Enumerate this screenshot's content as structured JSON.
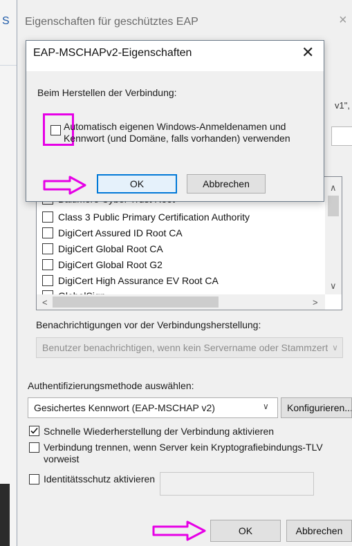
{
  "background_window": {
    "edge_letter": "S"
  },
  "main_dialog": {
    "title": "Eigenschaften für geschütztes EAP",
    "close_glyph": "×",
    "hidden_fragment": "v1\",",
    "certificates": [
      {
        "label": "Baltimore Cyber Trust Root",
        "checked": false
      },
      {
        "label": "Class 3 Public Primary Certification Authority",
        "checked": false
      },
      {
        "label": "DigiCert Assured ID Root CA",
        "checked": false
      },
      {
        "label": "DigiCert Global Root CA",
        "checked": false
      },
      {
        "label": "DigiCert Global Root G2",
        "checked": false
      },
      {
        "label": "DigiCert High Assurance EV Root CA",
        "checked": false
      },
      {
        "label": "GlobalSign",
        "checked": false
      }
    ],
    "scroll_up": "∧",
    "scroll_down": "∨",
    "scroll_left": "<",
    "scroll_right": ">",
    "notify_label": "Benachrichtigungen vor der Verbindungsherstellung:",
    "notify_value": "Benutzer benachrichtigen, wenn kein Servername oder Stammzertifikat angegeben ist",
    "auth_method_label": "Authentifizierungsmethode auswählen:",
    "auth_method_value": "Gesichertes Kennwort (EAP-MSCHAP v2)",
    "configure_label": "Konfigurieren...",
    "fast_reconnect_label": "Schnelle Wiederherstellung der Verbindung aktivieren",
    "fast_reconnect_checked": true,
    "disconnect_label": "Verbindung trennen, wenn Server kein Kryptografiebindungs-TLV vorweist",
    "disconnect_checked": false,
    "identity_label": "Identitätsschutz aktivieren",
    "identity_checked": false,
    "ok_label": "OK",
    "cancel_label": "Abbrechen"
  },
  "mschap_dialog": {
    "title": "EAP-MSCHAPv2-Eigenschaften",
    "close_glyph": "✕",
    "section_label": "Beim Herstellen der Verbindung:",
    "autologon_label": "Automatisch eigenen Windows-Anmeldenamen und Kennwort (und Domäne, falls vorhanden) verwenden",
    "autologon_checked": false,
    "ok_label": "OK",
    "cancel_label": "Abbrechen"
  },
  "colors": {
    "highlight": "#e600e6",
    "primary_button_border": "#0078d7"
  }
}
